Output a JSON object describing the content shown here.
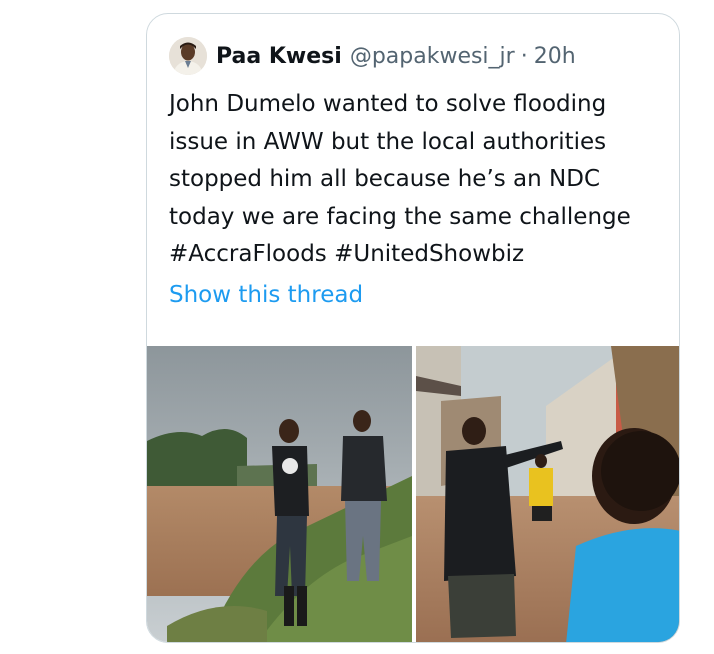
{
  "tweet": {
    "author_name": "Paa Kwesi",
    "handle": "@papakwesi_jr",
    "separator": "·",
    "time": "20h",
    "text_lines": [
      "John Dumelo wanted to solve flooding",
      "issue in AWW but the local authorities",
      "stopped him all because he’s an NDC",
      "today we are facing the same challenge",
      "#AccraFloods #UnitedShowbiz"
    ],
    "show_thread_label": "Show this thread"
  },
  "colors": {
    "text_primary": "#0f1419",
    "text_secondary": "#536471",
    "link": "#1d9bf0",
    "border": "#cfd9de"
  },
  "icons": {
    "avatar": "profile-photo"
  }
}
